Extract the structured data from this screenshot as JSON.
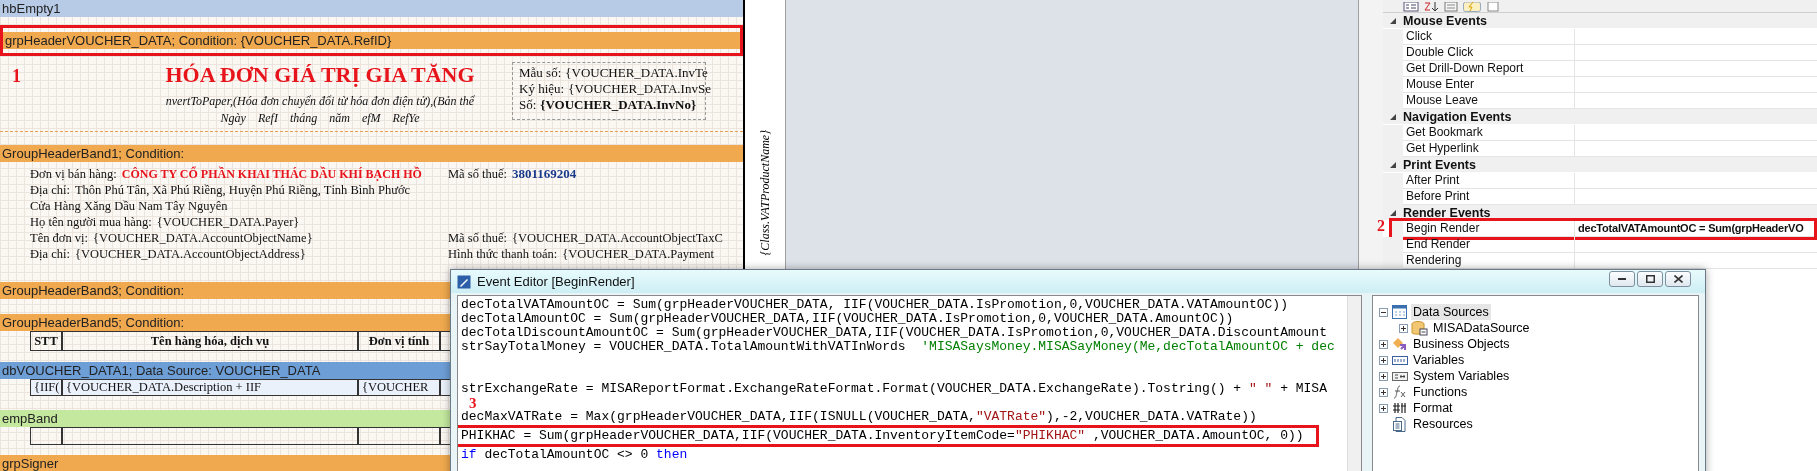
{
  "designer": {
    "bands": [
      {
        "label": "hbEmpty1",
        "kind": "page",
        "highlighted": false
      },
      {
        "label": "grpHeaderVOUCHER_DATA; Condition: {VOUCHER_DATA.RefID}",
        "kind": "group",
        "highlighted": true,
        "content": {
          "kind": "title-block",
          "marker": "1",
          "title": "HÓA ĐƠN GIÁ TRỊ GIA TĂNG",
          "subtitle": "nvertToPaper,(Hóa đơn chuyển đổi từ hóa đơn điện tử),(Bản thể",
          "date_fields": [
            "Ngày",
            "RefI",
            "tháng",
            "năm",
            "efM",
            "RefYe"
          ],
          "invoice_fields": [
            {
              "label": "Mẫu số:",
              "value": "{VOUCHER_DATA.InvTe",
              "bold": false
            },
            {
              "label": "Ký hiệu:",
              "value": "{VOUCHER_DATA.InvSe",
              "bold": false
            },
            {
              "label": "Số:",
              "value": "{VOUCHER_DATA.InvNo}",
              "bold": true
            }
          ]
        }
      },
      {
        "label": "GroupHeaderBand1; Condition:",
        "kind": "group",
        "highlighted": false,
        "content": {
          "kind": "info-rows",
          "rows": [
            {
              "kind": "seller",
              "label": "Đơn vị bán hàng:",
              "value": "CÔNG TY CỔ PHẦN KHAI THÁC DẦU KHÍ BẠCH HỒ",
              "right_label": "Mã số thuế:",
              "right_value": "3801169204"
            },
            {
              "kind": "plain",
              "label": "Địa chỉ:",
              "value": "Thôn Phú Tân, Xã Phú Riềng, Huyện Phú Riềng, Tỉnh Bình Phước"
            },
            {
              "kind": "plain",
              "value": "Cửa Hàng Xăng Dầu Nam Tây Nguyên"
            },
            {
              "kind": "plain",
              "label": "Họ tên người mua hàng:",
              "value": "{VOUCHER_DATA.Payer}"
            },
            {
              "kind": "plain",
              "label": "Tên đơn vị:",
              "value": "{VOUCHER_DATA.AccountObjectName}",
              "right_label": "Mã số thuế:",
              "right_value": "{VOUCHER_DATA.AccountObjectTaxC"
            },
            {
              "kind": "plain",
              "label": "Địa chỉ:",
              "value": "{VOUCHER_DATA.AccountObjectAddress}",
              "right_label": "Hình thức thanh toán:",
              "right_value": "{VOUCHER_DATA.Payment"
            }
          ]
        }
      },
      {
        "label": "GroupHeaderBand3; Condition:",
        "kind": "group",
        "highlighted": false
      },
      {
        "label": "GroupHeaderBand5; Condition:",
        "kind": "group",
        "highlighted": false,
        "content": {
          "kind": "table-header",
          "cells": [
            "STT",
            "Tên hàng hóa, dịch vụ",
            "Đơn vị tính"
          ]
        }
      },
      {
        "label": "dbVOUCHER_DATA1; Data Source: VOUCHER_DATA",
        "kind": "data",
        "highlighted": false,
        "content": {
          "kind": "table-row",
          "cells": [
            "{IIF(",
            "{VOUCHER_DATA.Description + IIF",
            "{VOUCHER"
          ]
        }
      },
      {
        "label": "empBand",
        "kind": "empty",
        "highlighted": false,
        "content": {
          "kind": "blank-row"
        }
      },
      {
        "label": "grpSigner",
        "kind": "group",
        "highlighted": false
      }
    ],
    "side_caption": "{Class.VATProductName}"
  },
  "properties": {
    "categories": [
      {
        "name": "Mouse Events",
        "expanded": true,
        "items": [
          {
            "name": "Click",
            "highlighted": false
          },
          {
            "name": "Double Click",
            "highlighted": false
          },
          {
            "name": "Get Drill-Down Report",
            "highlighted": false
          },
          {
            "name": "Mouse Enter",
            "highlighted": false
          },
          {
            "name": "Mouse Leave",
            "highlighted": false
          }
        ]
      },
      {
        "name": "Navigation Events",
        "expanded": true,
        "items": [
          {
            "name": "Get Bookmark",
            "highlighted": false
          },
          {
            "name": "Get Hyperlink",
            "highlighted": false
          }
        ]
      },
      {
        "name": "Print Events",
        "expanded": true,
        "items": [
          {
            "name": "After Print",
            "highlighted": false
          },
          {
            "name": "Before Print",
            "highlighted": false
          }
        ]
      },
      {
        "name": "Render Events",
        "expanded": true,
        "items": [
          {
            "name": "Begin Render",
            "value": "decTotalVATAmountOC = Sum(grpHeaderVO",
            "highlighted": true,
            "marker": "2"
          },
          {
            "name": "End Render",
            "highlighted": false
          },
          {
            "name": "Rendering",
            "highlighted": false
          }
        ]
      }
    ]
  },
  "event_editor": {
    "title": "Event Editor [BeginRender]",
    "code_lines": [
      {
        "highlighted": false,
        "segments": [
          {
            "kind": "code",
            "text": "decTotalVATAmountOC = Sum(grpHeaderVOUCHER_DATA, IIF(VOUCHER_DATA.IsPromotion,0,VOUCHER_DATA.VATAmountOC))"
          }
        ]
      },
      {
        "highlighted": false,
        "segments": [
          {
            "kind": "code",
            "text": "decTotalAmountOC = Sum(grpHeaderVOUCHER_DATA,IIF(VOUCHER_DATA.IsPromotion,0,VOUCHER_DATA.AmountOC))"
          }
        ]
      },
      {
        "highlighted": false,
        "segments": [
          {
            "kind": "code",
            "text": "decTotalDiscountAmountOC = Sum(grpHeaderVOUCHER_DATA,IIF(VOUCHER_DATA.IsPromotion,0,VOUCHER_DATA.DiscountAmount"
          }
        ]
      },
      {
        "highlighted": false,
        "segments": [
          {
            "kind": "code",
            "text": "strSayTotalMoney = VOUCHER_DATA.TotalAmountWithVATInWords  "
          },
          {
            "kind": "comment",
            "text": "'MISASaysMoney.MISASayMoney(Me,decTotalAmountOC + dec"
          }
        ]
      },
      {
        "highlighted": false
      },
      {
        "highlighted": false
      },
      {
        "highlighted": false,
        "segments": [
          {
            "kind": "code",
            "text": "strExchangeRate = MISAReportFormat.ExchangeRateFormat.Format(VOUCHER_DATA.ExchangeRate).Tostring() + "
          },
          {
            "kind": "string",
            "text": "\" \""
          },
          {
            "kind": "code",
            "text": " + MISA"
          }
        ]
      },
      {
        "highlighted": false,
        "marker": "3"
      },
      {
        "highlighted": false,
        "segments": [
          {
            "kind": "code",
            "text": "decMaxVATRate = Max(grpHeaderVOUCHER_DATA,IIF(ISNULL(VOUCHER_DATA,"
          },
          {
            "kind": "string",
            "text": "\"VATRate\""
          },
          {
            "kind": "code",
            "text": "),-2,VOUCHER_DATA.VATRate))"
          }
        ]
      },
      {
        "highlighted": true,
        "segments": [
          {
            "kind": "code",
            "text": "PHIKHAC = Sum(grpHeaderVOUCHER_DATA,IIF(VOUCHER_DATA.InventoryItemCode="
          },
          {
            "kind": "string",
            "text": "\"PHIKHAC\""
          },
          {
            "kind": "code",
            "text": " ,VOUCHER_DATA.AmountOC, 0))"
          }
        ]
      },
      {
        "highlighted": false,
        "segments": [
          {
            "kind": "keyword",
            "text": "if"
          },
          {
            "kind": "code",
            "text": " decTotalAmountOC <> 0 "
          },
          {
            "kind": "keyword",
            "text": "then"
          }
        ]
      }
    ],
    "tree": [
      {
        "label": "Data Sources",
        "kind": "table",
        "expanded": true,
        "selected": true,
        "children": [
          {
            "label": "MISADataSource",
            "kind": "database",
            "expanded": false,
            "selected": false
          }
        ]
      },
      {
        "label": "Business Objects",
        "kind": "objects",
        "expanded": false,
        "selected": false
      },
      {
        "label": "Variables",
        "kind": "variables",
        "expanded": false,
        "selected": false
      },
      {
        "label": "System Variables",
        "kind": "system",
        "expanded": false,
        "selected": false
      },
      {
        "label": "Functions",
        "kind": "function",
        "expanded": false,
        "selected": false
      },
      {
        "label": "Format",
        "kind": "format",
        "expanded": false,
        "selected": false
      },
      {
        "label": "Resources",
        "kind": "document",
        "selected": false
      }
    ]
  }
}
